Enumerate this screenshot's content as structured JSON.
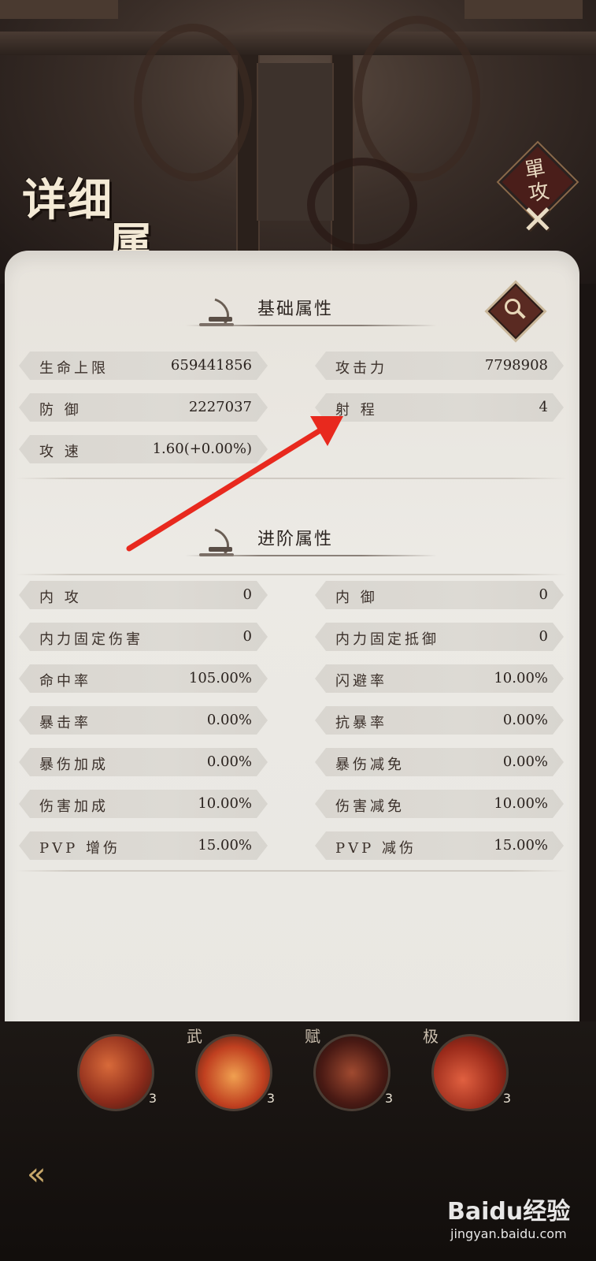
{
  "header": {
    "title_line1": "详细",
    "title_line2": "属性",
    "close_label_line1": "單",
    "close_label_line2": "攻",
    "close_icon": "close-icon"
  },
  "basic": {
    "title": "基础属性",
    "stats": [
      {
        "name": "生命上限",
        "value": "659441856"
      },
      {
        "name": "攻击力",
        "value": "7798908"
      },
      {
        "name": "防 御",
        "value": "2227037"
      },
      {
        "name": "射 程",
        "value": "4"
      },
      {
        "name": "攻 速",
        "value": "1.60(+0.00%)"
      }
    ]
  },
  "advanced": {
    "title": "进阶属性",
    "stats": [
      {
        "name": "内 攻",
        "value": "0"
      },
      {
        "name": "内 御",
        "value": "0"
      },
      {
        "name": "内力固定伤害",
        "value": "0"
      },
      {
        "name": "内力固定抵御",
        "value": "0"
      },
      {
        "name": "命中率",
        "value": "105.00%"
      },
      {
        "name": "闪避率",
        "value": "10.00%"
      },
      {
        "name": "暴击率",
        "value": "0.00%"
      },
      {
        "name": "抗暴率",
        "value": "0.00%"
      },
      {
        "name": "暴伤加成",
        "value": "0.00%"
      },
      {
        "name": "暴伤减免",
        "value": "0.00%"
      },
      {
        "name": "伤害加成",
        "value": "10.00%"
      },
      {
        "name": "伤害减免",
        "value": "10.00%"
      },
      {
        "name": "PVP 增伤",
        "value": "15.00%"
      },
      {
        "name": "PVP 减伤",
        "value": "15.00%"
      }
    ]
  },
  "skills": [
    {
      "badge": "",
      "level": "3"
    },
    {
      "badge": "武",
      "level": "3"
    },
    {
      "badge": "赋",
      "level": "3"
    },
    {
      "badge": "极",
      "level": "3"
    }
  ],
  "watermark": {
    "brand": "Baidu经验",
    "site": "jingyan.baidu.com"
  },
  "colors": {
    "panel": "#e9e7e2",
    "row": "#dad7d1",
    "accent_red": "#e8291e",
    "dark_bg": "#1a1412"
  }
}
